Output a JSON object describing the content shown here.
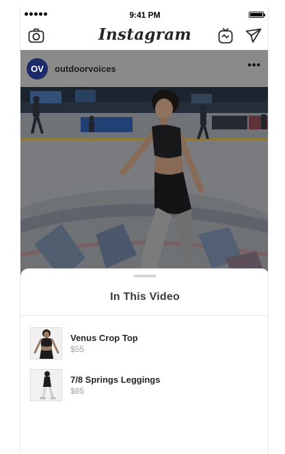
{
  "status_bar": {
    "time": "9:41 PM",
    "signal_bars": 5,
    "battery": "full"
  },
  "nav": {
    "logo": "Instagram",
    "left_icon": "camera-icon",
    "right_icons": [
      "igtv-icon",
      "direct-message-icon"
    ]
  },
  "post": {
    "avatar_text": "OV",
    "username": "outdoorvoices",
    "more_label": "•••",
    "media": "figure-skater-video"
  },
  "sheet": {
    "title": "In This Video",
    "products": [
      {
        "name": "Venus Crop Top",
        "price": "$55"
      },
      {
        "name": "7/8 Springs Leggings",
        "price": "$85"
      }
    ]
  },
  "colors": {
    "avatar": "#1c2a6b",
    "overlay": "#8a8a8a",
    "accent_text": "#262626",
    "price": "#a0a0a0"
  }
}
